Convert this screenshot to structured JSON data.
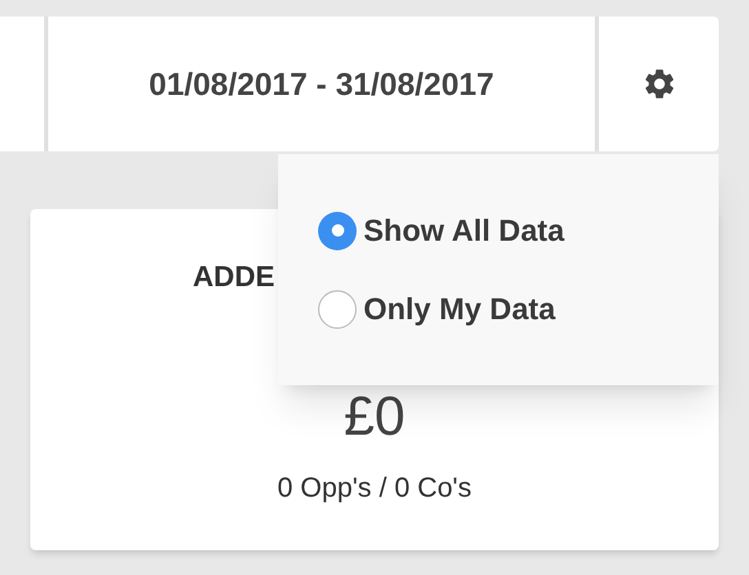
{
  "toolbar": {
    "date_range": "01/08/2017 - 31/08/2017"
  },
  "card": {
    "title": "ADDE",
    "value": "£0",
    "subtitle": "0 Opp's / 0 Co's"
  },
  "dropdown": {
    "options": [
      {
        "label": "Show All Data",
        "selected": true
      },
      {
        "label": "Only My Data",
        "selected": false
      }
    ]
  }
}
